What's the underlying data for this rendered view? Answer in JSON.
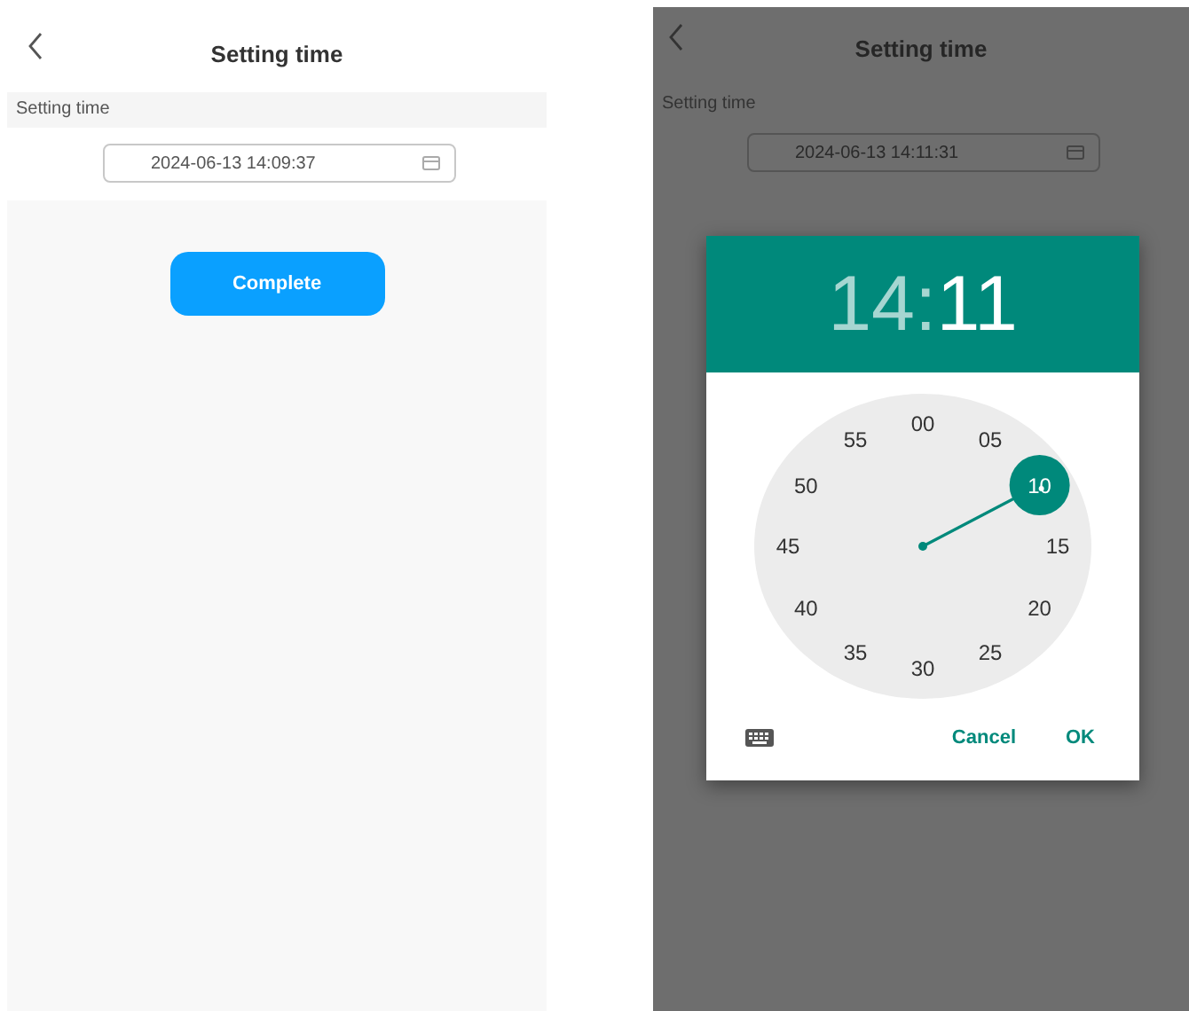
{
  "screens": [
    {
      "dimmed": false,
      "title": "Setting time",
      "field_label": "Setting time",
      "datetime_value": "2024-06-13 14:09:37",
      "button": "Complete"
    },
    {
      "dimmed": true,
      "title": "Setting time",
      "field_label": "Setting time",
      "datetime_value": "2024-06-13 14:11:31",
      "dialog": {
        "hour": {
          "text": "14",
          "selected": false
        },
        "separator": ":",
        "minute": {
          "text": "11",
          "selected": true
        },
        "dial": [
          {
            "label": "00",
            "selected": false
          },
          {
            "label": "05",
            "selected": false
          },
          {
            "label": "10",
            "selected": true
          },
          {
            "label": "15",
            "selected": false
          },
          {
            "label": "20",
            "selected": false
          },
          {
            "label": "25",
            "selected": false
          },
          {
            "label": "30",
            "selected": false
          },
          {
            "label": "35",
            "selected": false
          },
          {
            "label": "40",
            "selected": false
          },
          {
            "label": "45",
            "selected": false
          },
          {
            "label": "50",
            "selected": false
          },
          {
            "label": "55",
            "selected": false
          }
        ],
        "buttons": [
          "Cancel",
          "OK"
        ]
      }
    }
  ]
}
